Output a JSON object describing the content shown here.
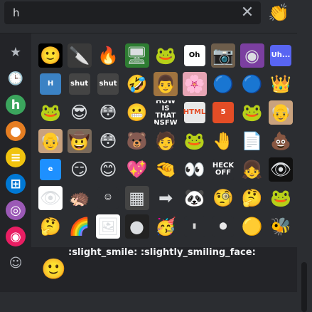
{
  "search": {
    "value": "h",
    "clear_icon": "close-icon",
    "clear_glyph": "✕",
    "emoji_button_glyph": "👏"
  },
  "sidebar": {
    "items": [
      {
        "name": "star-icon",
        "glyph": "★",
        "color": "#b5bac1"
      },
      {
        "name": "clock-icon",
        "glyph": "🕒",
        "color": "#b5bac1"
      },
      {
        "name": "server-icon-h-green",
        "glyph": "h",
        "color": "#3ba55d"
      },
      {
        "name": "server-icon-orange",
        "glyph": "●",
        "color": "#e67e22"
      },
      {
        "name": "server-icon-yellow-stack",
        "glyph": "≡",
        "color": "#f1c40f"
      },
      {
        "name": "server-icon-windows",
        "glyph": "⊞",
        "color": "#0078d4"
      },
      {
        "name": "server-icon-purple-gradient",
        "glyph": "◎",
        "color": "#9b59b6"
      },
      {
        "name": "server-icon-pink-character",
        "glyph": "◉",
        "color": "#e91e63"
      },
      {
        "name": "smiley-icon",
        "glyph": "☺",
        "color": "#b5bac1"
      }
    ]
  },
  "grid": {
    "rows": [
      [
        {
          "n": "slight-smile",
          "g": "🙂",
          "c": "#000000",
          "hi": true
        },
        {
          "n": "custom-knife",
          "g": "🔪",
          "c": "#3a3a3a"
        },
        {
          "n": "custom-blue-fire",
          "g": "🔥",
          "c": "#2b2d31"
        },
        {
          "n": "custom-pepe-screen",
          "g": "🖥",
          "c": "#2e7d32"
        },
        {
          "n": "custom-pepe-hmm",
          "g": "🐸",
          "c": "#2b2d31"
        },
        {
          "n": "custom-oh-bubble",
          "g": "Oh",
          "c": "#ffffff",
          "t": "#000000",
          "tile": true
        },
        {
          "n": "custom-photo",
          "g": "📷",
          "c": "#6d5d4b"
        },
        {
          "n": "custom-purple-face",
          "g": "◉",
          "c": "#7b3fa0"
        },
        {
          "n": "custom-uh-bubble",
          "g": "Uh...",
          "c": "#5865f2",
          "t": "#ffffff",
          "tile": true
        }
      ],
      [
        {
          "n": "custom-h-letter",
          "g": "H",
          "c": "#3b82c4",
          "t": "#ffffff",
          "tile": true
        },
        {
          "n": "custom-shut-hand",
          "g": "shut",
          "c": "#444444",
          "t": "#ffffff",
          "tile": true
        },
        {
          "n": "custom-shut-hand-2",
          "g": "shut",
          "c": "#444444",
          "t": "#ffffff",
          "tile": true
        },
        {
          "n": "custom-laughing",
          "g": "🤣",
          "c": "#2b2d31"
        },
        {
          "n": "custom-photo-man",
          "g": "👨",
          "c": "#a0743f"
        },
        {
          "n": "custom-pink-anime",
          "g": "🌸",
          "c": "#e6a4b4"
        },
        {
          "n": "custom-blue-blob",
          "g": "🔵",
          "c": "#2b2d31"
        },
        {
          "n": "custom-blue-blob-2",
          "g": "🔵",
          "c": "#2b2d31"
        },
        {
          "n": "custom-crown-blob",
          "g": "👑",
          "c": "#2b2d31"
        }
      ],
      [
        {
          "n": "custom-green-frog",
          "g": "🐸",
          "c": "#2b2d31"
        },
        {
          "n": "custom-sunglasses-face",
          "g": "😎",
          "c": "#2b2d31"
        },
        {
          "n": "custom-flushed-face",
          "g": "😳",
          "c": "#2b2d31"
        },
        {
          "n": "custom-grimace",
          "g": "😬",
          "c": "#2b2d31"
        },
        {
          "n": "custom-how-nsfw",
          "g": "HOW IS THAT NSFW",
          "c": "#2b2d31",
          "t": "#ffffff",
          "tile": true
        },
        {
          "n": "custom-html-file",
          "g": "HTML",
          "c": "#e8e8e8",
          "t": "#e44d26",
          "tile": true
        },
        {
          "n": "custom-html5",
          "g": "5",
          "c": "#e44d26",
          "t": "#ffffff",
          "tile": true
        },
        {
          "n": "custom-pepe-glasses",
          "g": "🐸",
          "c": "#2b2d31"
        },
        {
          "n": "custom-old-man",
          "g": "👴",
          "c": "#c9a27e"
        }
      ],
      [
        {
          "n": "custom-hide-pain-harold",
          "g": "👴",
          "c": "#c9a27e"
        },
        {
          "n": "custom-hat-man",
          "g": "🤠",
          "c": "#7a6a5a"
        },
        {
          "n": "custom-pink-face",
          "g": "😳",
          "c": "#2b2d31"
        },
        {
          "n": "custom-bear",
          "g": "🐻",
          "c": "#2b2d31"
        },
        {
          "n": "custom-cartoon-guy",
          "g": "🧑",
          "c": "#2b2d31"
        },
        {
          "n": "custom-pepe-hat",
          "g": "🐸",
          "c": "#2b2d31"
        },
        {
          "n": "custom-hand-orange",
          "g": "🤚",
          "c": "#2b2d31"
        },
        {
          "n": "custom-paper-list",
          "g": "📄",
          "c": "#2b2d31"
        },
        {
          "n": "custom-poop",
          "g": "💩",
          "c": "#2b2d31"
        }
      ],
      [
        {
          "n": "custom-ie-logo",
          "g": "e",
          "c": "#1e90ff",
          "t": "#ffffff",
          "tile": true
        },
        {
          "n": "custom-smirk",
          "g": "😏",
          "c": "#2b2d31"
        },
        {
          "n": "custom-blush",
          "g": "😊",
          "c": "#2b2d31"
        },
        {
          "n": "custom-heart-color",
          "g": "💖",
          "c": "#2b2d31"
        },
        {
          "n": "custom-hand-cup",
          "g": "🤏",
          "c": "#2b2d31"
        },
        {
          "n": "custom-eyes",
          "g": "👀",
          "c": "#2b2d31"
        },
        {
          "n": "custom-heck-off",
          "g": "HECK OFF",
          "c": "#2b2d31",
          "t": "#ffffff",
          "tile": true
        },
        {
          "n": "custom-anime-girl",
          "g": "👧",
          "c": "#2b2d31"
        },
        {
          "n": "custom-eye-black",
          "g": "👁",
          "c": "#111111"
        }
      ],
      [
        {
          "n": "custom-eye-white",
          "g": "👁",
          "c": "#ffffff"
        },
        {
          "n": "custom-sonic",
          "g": "🦔",
          "c": "#2b2d31"
        },
        {
          "n": "custom-smile-outline",
          "g": "☺",
          "c": "#2b2d31",
          "t": "#ffffff",
          "tile": true
        },
        {
          "n": "custom-photo-dark",
          "g": "▦",
          "c": "#444444"
        },
        {
          "n": "custom-arrow-right",
          "g": "➡",
          "c": "#2b2d31"
        },
        {
          "n": "custom-panda",
          "g": "🐼",
          "c": "#2b2d31"
        },
        {
          "n": "custom-monocle",
          "g": "🧐",
          "c": "#2b2d31"
        },
        {
          "n": "custom-thinking",
          "g": "🤔",
          "c": "#2b2d31"
        },
        {
          "n": "custom-green-cartoon",
          "g": "🐸",
          "c": "#2b2d31"
        }
      ],
      [
        {
          "n": "custom-thinking-hand",
          "g": "🤔",
          "c": "#2b2d31"
        },
        {
          "n": "custom-rainbow-text",
          "g": "🌈",
          "c": "#2b2d31"
        },
        {
          "n": "custom-meme-photo",
          "g": "🖼",
          "c": "#ffffff"
        },
        {
          "n": "custom-dark-orb",
          "g": "●",
          "c": "#222222"
        },
        {
          "n": "custom-party-face",
          "g": "🥳",
          "c": "#2b2d31"
        },
        {
          "n": "custom-white-rect",
          "g": "▮",
          "c": "#2b2d31",
          "t": "#d8d8d8",
          "tile": true
        },
        {
          "n": "custom-white-circle",
          "g": "⬤",
          "c": "#2b2d31",
          "t": "#e8e8e8",
          "tile": true
        },
        {
          "n": "custom-yellow-black-ball",
          "g": "🟡",
          "c": "#2b2d31"
        },
        {
          "n": "custom-bee",
          "g": "🐝",
          "c": "#2b2d31"
        }
      ]
    ]
  },
  "footer": {
    "emoji": "🙂",
    "names": ":slight_smile: :slightly_smiling_face:"
  }
}
